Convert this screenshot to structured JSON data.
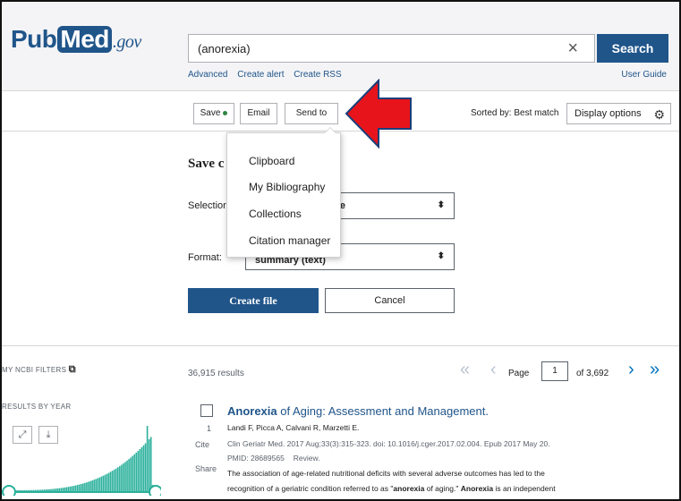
{
  "header": {
    "logo_pub": "Pub",
    "logo_med": "Med",
    "logo_gov": ".gov",
    "search_value": "(anorexia)",
    "search_button": "Search",
    "links": [
      "Advanced",
      "Create alert",
      "Create RSS"
    ],
    "user_guide": "User Guide"
  },
  "toolbar": {
    "save": "Save",
    "email": "Email",
    "send_to": "Send to",
    "sorted_by": "Sorted by: Best match",
    "display_options": "Display options"
  },
  "save_panel": {
    "title_visible": "Save c",
    "selection_label": "Selectior",
    "selection_value_visible": "age",
    "format_label": "Format:",
    "format_value_visible": "summary (text)",
    "create_file": "Create file",
    "cancel": "Cancel"
  },
  "send_to_menu": {
    "items": [
      "Clipboard",
      "My Bibliography",
      "Collections",
      "Citation manager"
    ]
  },
  "sidebar": {
    "my_ncbi_filters": "MY NCBI FILTERS",
    "results_by_year": "RESULTS BY YEAR"
  },
  "results": {
    "count": "36,915 results",
    "page_label": "Page",
    "page_value": "1",
    "of_pages": "of 3,692"
  },
  "article": {
    "number": "1",
    "title_bold": "Anorexia",
    "title_rest": " of Aging: Assessment and Management.",
    "authors": "Landi F, Picca A, Calvani R, Marzetti E.",
    "citation": "Clin Geriatr Med. 2017 Aug;33(3):315-323. doi: 10.1016/j.cger.2017.02.004. Epub 2017 May 20.",
    "pmid": "PMID: 28689565",
    "type": "Review.",
    "cite": "Cite",
    "share": "Share",
    "snippet_1": "The association of age-related nutritional deficits with several adverse outcomes has led to the",
    "snippet_2a": "recognition of a geriatric condition referred to as \"",
    "snippet_2b": "anorexia",
    "snippet_2c": " of aging.\" ",
    "snippet_2d": "Anorexia",
    "snippet_2e": " is an independent"
  },
  "colors": {
    "brand": "#20558a",
    "annotation_arrow": "#e8141b",
    "histogram": "#2ab09b"
  }
}
